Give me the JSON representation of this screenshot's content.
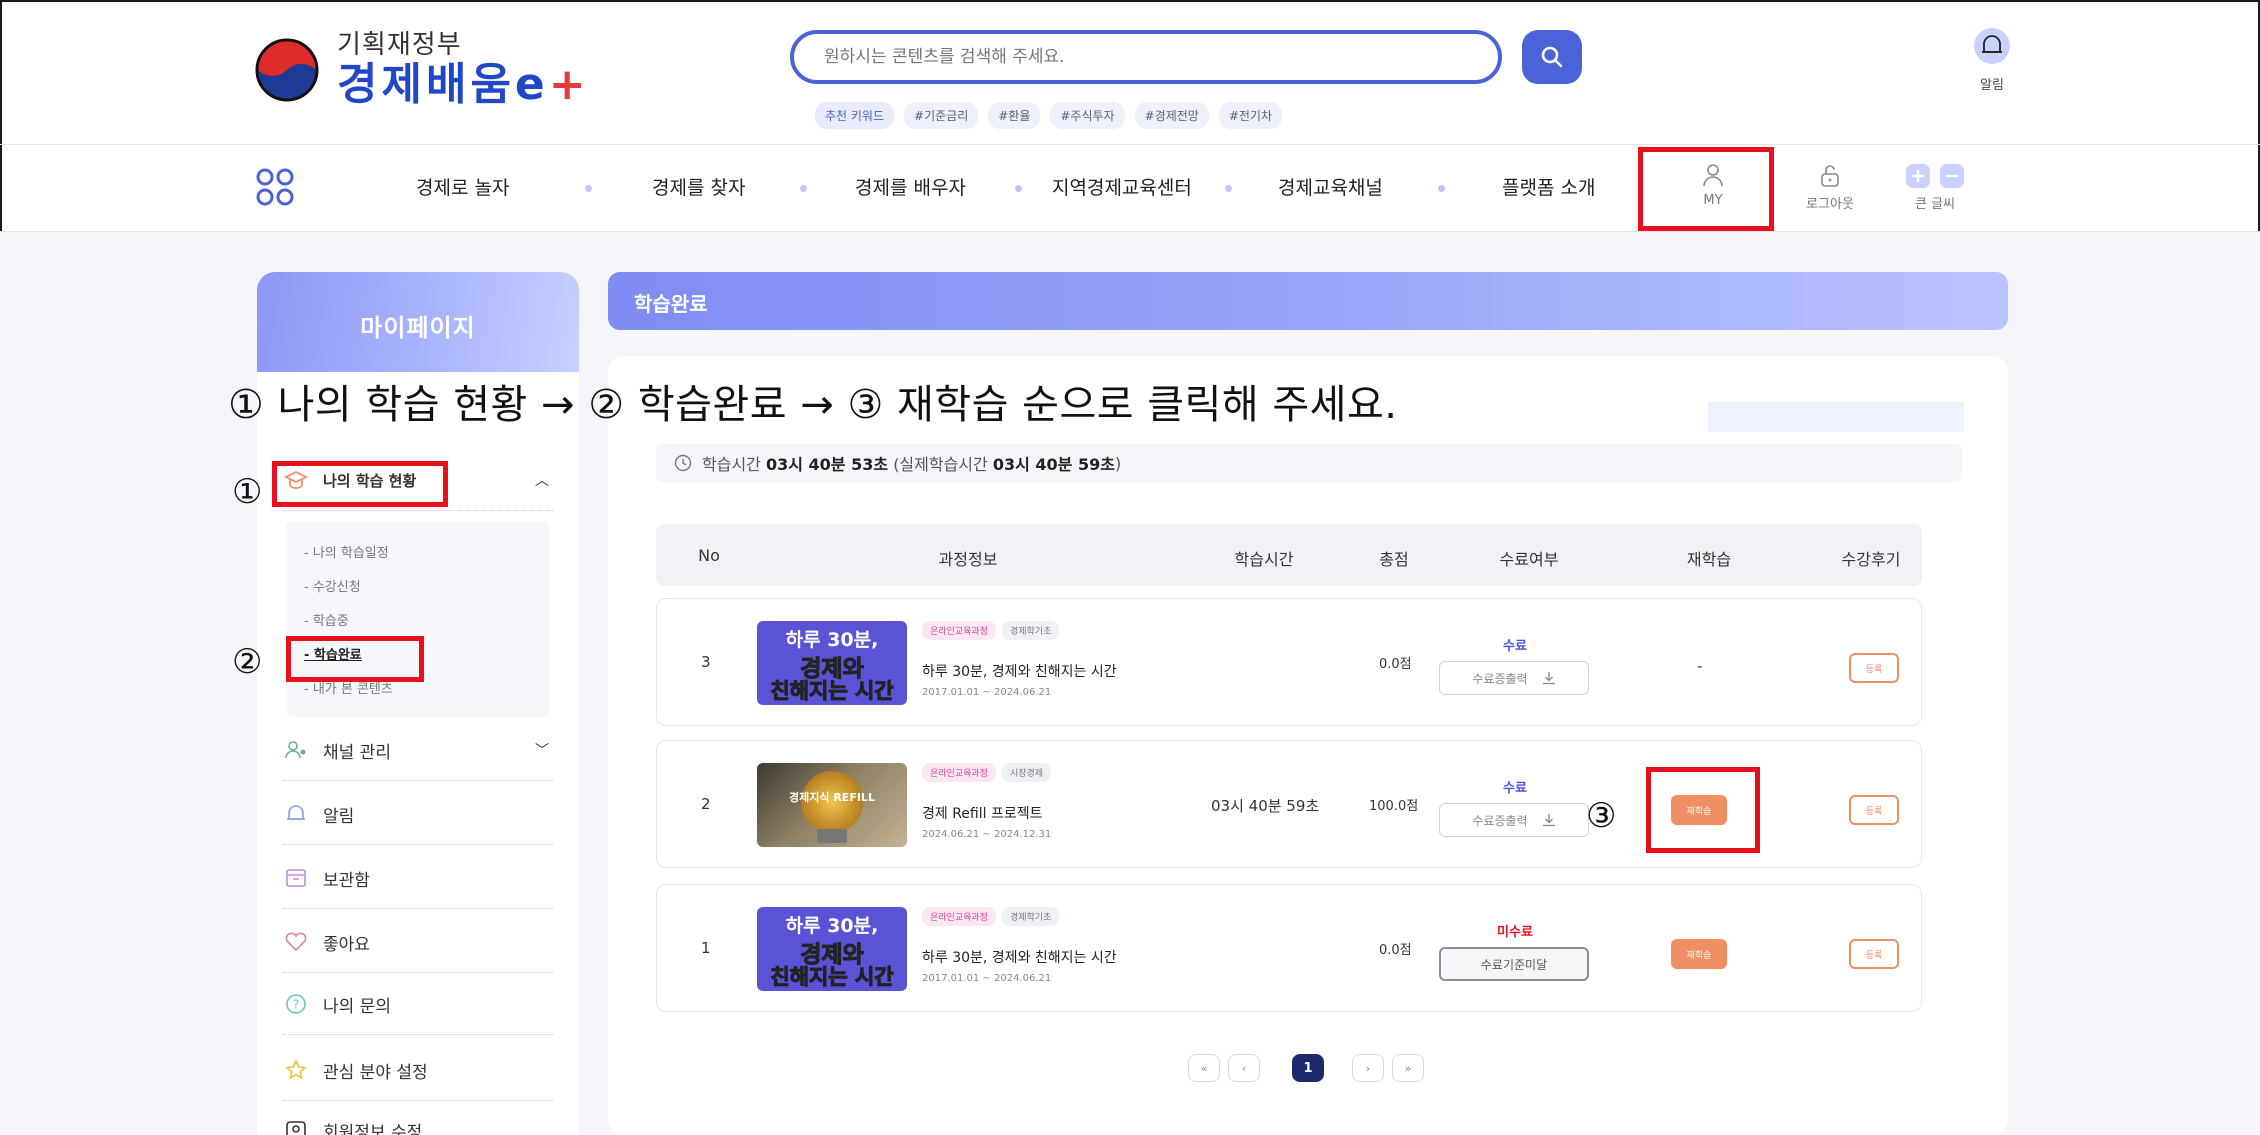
{
  "header": {
    "logo_ministry": "기획재정부",
    "logo_title": "경제배움",
    "logo_suffix_e": "e",
    "logo_suffix_plus": "+",
    "search_placeholder": "원하시는 콘텐츠를 검색해 주세요.",
    "keywords_label": "추천 키워드",
    "keywords": [
      "#기준금리",
      "#환율",
      "#주식투자",
      "#경제전망",
      "#전기차"
    ],
    "alarm_label": "알림"
  },
  "nav": {
    "items": [
      "경제로 놀자",
      "경제를 찾자",
      "경제를 배우자",
      "지역경제교육센터",
      "경제교육채널",
      "플랫폼 소개"
    ],
    "my": "MY",
    "logout": "로그아웃",
    "large_font": "큰 글씨"
  },
  "sidebar": {
    "title": "마이페이지",
    "my_learning": "나의 학습 현황",
    "sub_items": [
      "- 나의 학습일정",
      "- 수강신청",
      "- 학습중",
      "- 학습완료",
      "- 내가 본 콘텐츠"
    ],
    "channel": "채널 관리",
    "alarm": "알림",
    "storage": "보관함",
    "likes": "좋아요",
    "inquiry": "나의 문의",
    "interest": "관심 분야 설정",
    "member_edit": "회원정보 수정"
  },
  "annotations": {
    "instruction": "① 나의 학습 현황 → ② 학습완료 → ③ 재학습 순으로 클릭해 주세요.",
    "n1": "①",
    "n2": "②",
    "n3": "③"
  },
  "main": {
    "title": "학습완료",
    "study_time_prefix": "학습시간",
    "study_time": "03시 40분 53초",
    "actual_prefix": "(실제학습시간",
    "actual_time": "03시 40분 59초",
    "actual_suffix": ")",
    "columns": [
      "No",
      "과정정보",
      "학습시간",
      "총점",
      "수료여부",
      "재학습",
      "수강후기"
    ],
    "rows": [
      {
        "no": "3",
        "thumb_line1": "하루 30분,",
        "thumb_line2": "경제와",
        "thumb_line3": "친해지는 시간",
        "tag1": "온라인교육과정",
        "tag2": "경제학기초",
        "title": "하루 30분, 경제와 친해지는 시간",
        "date": "2017.01.01 ~ 2024.06.21",
        "time": "",
        "score": "0.0점",
        "status": "수료",
        "cert": "수료증출력",
        "retake": "-",
        "review": "등록"
      },
      {
        "no": "2",
        "thumb_label": "경제지식 REFILL",
        "tag1": "온라인교육과정",
        "tag2": "시장경제",
        "title": "경제 Refill 프로젝트",
        "date": "2024.06.21 ~ 2024.12.31",
        "time": "03시 40분 59초",
        "score": "100.0점",
        "status": "수료",
        "cert": "수료증출력",
        "retake": "재학습",
        "review": "등록"
      },
      {
        "no": "1",
        "thumb_line1": "하루 30분,",
        "thumb_line2": "경제와",
        "thumb_line3": "친해지는 시간",
        "tag1": "온라인교육과정",
        "tag2": "경제학기초",
        "title": "하루 30분, 경제와 친해지는 시간",
        "date": "2017.01.01 ~ 2024.06.21",
        "time": "",
        "score": "0.0점",
        "status": "미수료",
        "cert": "수료기준미달",
        "retake": "재학습",
        "review": "등록"
      }
    ]
  },
  "pagination": {
    "first": "«",
    "prev": "‹",
    "current": "1",
    "next": "›",
    "last": "»"
  },
  "colors": {
    "brand_blue": "#4a63d9",
    "highlight_red": "#e8101c",
    "retake_orange": "#f08f64",
    "done_purple": "#4a52d9"
  },
  "icons": [
    "search-icon",
    "bell-icon",
    "grid-menu-icon",
    "person-icon",
    "unlock-icon",
    "font-plus-icon",
    "font-minus-icon",
    "graduation-cap-icon",
    "chevron-up-icon",
    "chevron-down-icon",
    "channel-person-icon",
    "bell-icon",
    "archive-box-icon",
    "heart-icon",
    "question-icon",
    "star-icon",
    "id-card-icon",
    "clock-icon",
    "download-icon"
  ]
}
